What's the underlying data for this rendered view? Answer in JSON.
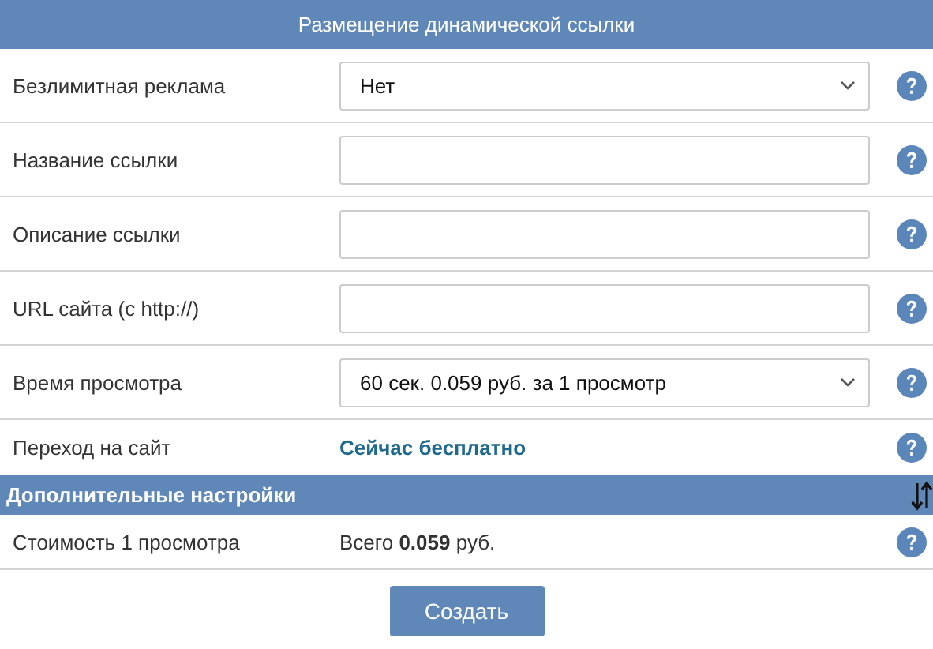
{
  "header": {
    "title": "Размещение динамической ссылки"
  },
  "rows": [
    {
      "kind": "select",
      "label": "Безлимитная реклама",
      "value": "Нет"
    },
    {
      "kind": "input",
      "label": "Название ссылки"
    },
    {
      "kind": "input",
      "label": "Описание ссылки"
    },
    {
      "kind": "input",
      "label": "URL сайта (с http://)"
    },
    {
      "kind": "select",
      "label": "Время просмотра",
      "value": "60 сек. 0.059 руб. за 1 просмотр"
    },
    {
      "kind": "text",
      "label": "Переход на сайт",
      "value": "Сейчас бесплатно"
    }
  ],
  "section": {
    "title": "Дополнительные настройки"
  },
  "extra_rows": [
    {
      "kind": "cost",
      "label": "Стоимость 1 просмотра",
      "value": "Всего **0.059** руб."
    }
  ],
  "submit": {
    "label": "Создать"
  }
}
